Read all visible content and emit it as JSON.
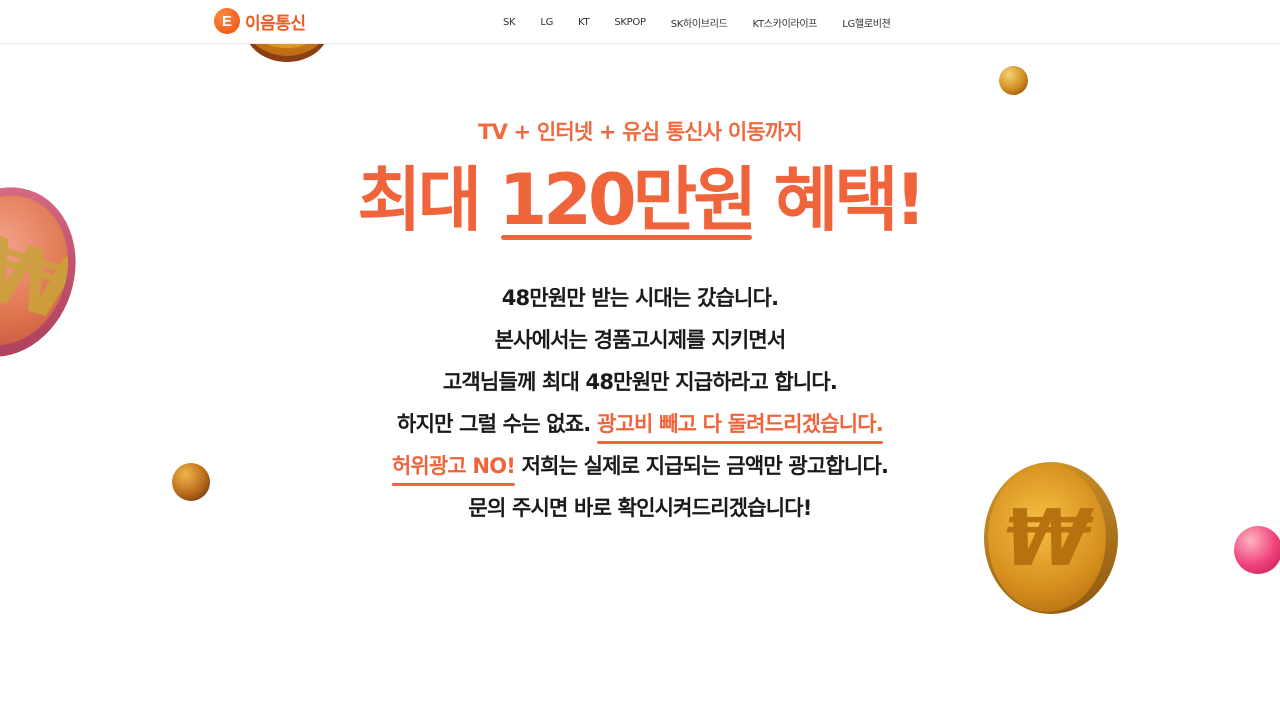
{
  "brand": {
    "logo_letter": "E",
    "name": "이음통신",
    "color": "#ef5a1e"
  },
  "nav": {
    "items": [
      "SK",
      "LG",
      "KT",
      "SKPOP",
      "SK하이브리드",
      "KT스카이라이프",
      "LG헬로비젼"
    ]
  },
  "hero": {
    "subtitle": "TV + 인터넷 + 유심 통신사 이동까지",
    "headline_prefix": "최대",
    "headline_amount": "120만원",
    "headline_suffix": "혜택!",
    "lines": [
      "48만원만 받는 시대는 갔습니다.",
      "본사에서는 경품고시제를 지키면서",
      "고객님들께 최대 48만원만 지급하라고 합니다."
    ],
    "line4_text": "하지만 그럴 수는 없죠.",
    "line4_highlight": "광고비 빼고 다 돌려드리겠습니다.",
    "line5_highlight": "허위광고 NO!",
    "line5_text": "저희는 실제로 지급되는 금액만 광고합니다.",
    "line6": "문의 주시면 바로 확인시켜드리겠습니다!",
    "accent_color": "#f0643c"
  },
  "decor": {
    "coin_symbol": "₩",
    "icons": [
      "won-coin-icon",
      "gold-sphere-icon",
      "pink-sphere-icon"
    ]
  }
}
